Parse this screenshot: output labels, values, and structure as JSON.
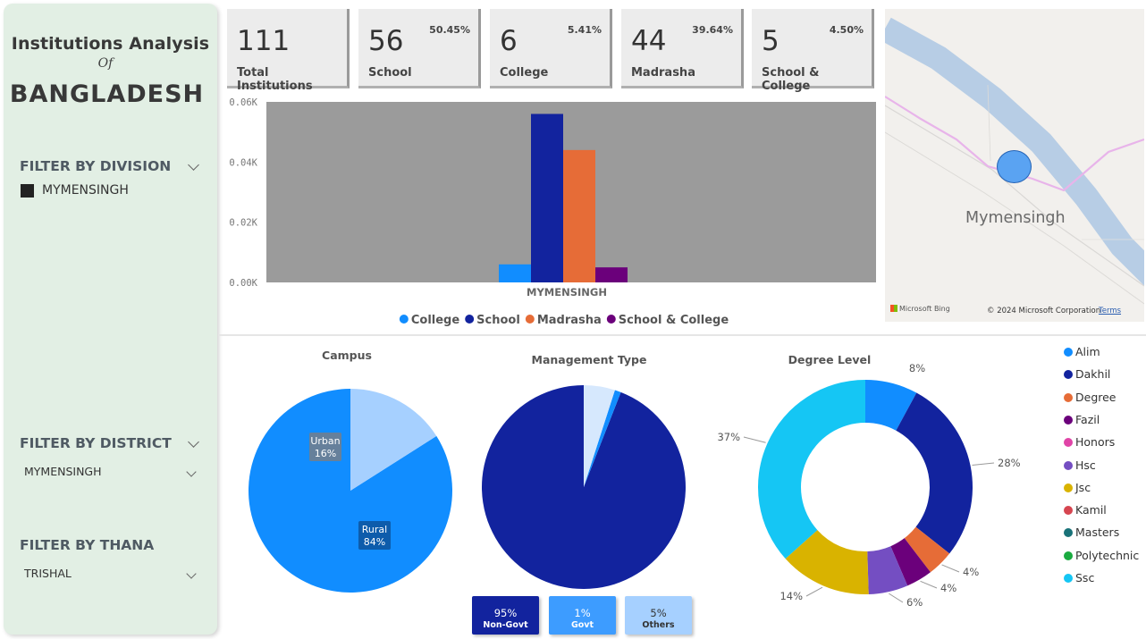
{
  "sidebar": {
    "title_line1": "Institutions Analysis",
    "title_of": "Of",
    "title_line2": "BANGLADESH",
    "division": {
      "label": "FILTER BY DIVISION",
      "selected": "MYMENSINGH"
    },
    "district": {
      "label": "FILTER BY DISTRICT",
      "value": "MYMENSINGH"
    },
    "thana": {
      "label": "FILTER BY THANA",
      "value": "TRISHAL"
    }
  },
  "kpis": [
    {
      "value": "111",
      "label": "Total Institutions",
      "pct": ""
    },
    {
      "value": "56",
      "label": "School",
      "pct": "50.45%"
    },
    {
      "value": "6",
      "label": "College",
      "pct": "5.41%"
    },
    {
      "value": "44",
      "label": "Madrasha",
      "pct": "39.64%"
    },
    {
      "value": "5",
      "label": "School & College",
      "pct": "4.50%"
    }
  ],
  "chart_data": [
    {
      "type": "bar",
      "categories": [
        "MYMENSINGH"
      ],
      "y_ticks": [
        "0.06K",
        "0.04K",
        "0.02K",
        "0.00K"
      ],
      "ylim": [
        0,
        60
      ],
      "legend_position": "bottom",
      "series": [
        {
          "name": "College",
          "values": [
            6
          ],
          "color": "#118dff"
        },
        {
          "name": "School",
          "values": [
            56
          ],
          "color": "#12239e"
        },
        {
          "name": "Madrasha",
          "values": [
            44
          ],
          "color": "#e66c37"
        },
        {
          "name": "School & College",
          "values": [
            5
          ],
          "color": "#6b007b"
        }
      ],
      "plot_background": "#9b9b9b"
    },
    {
      "type": "pie",
      "title": "Campus",
      "slices": [
        {
          "name": "Rural",
          "value": 84,
          "label": "84%",
          "color": "#118dff"
        },
        {
          "name": "Urban",
          "value": 16,
          "label": "16%",
          "color": "#a6d0ff"
        }
      ]
    },
    {
      "type": "pie",
      "title": "Management Type",
      "slices": [
        {
          "name": "Non-Govt",
          "value": 95,
          "label": "95%",
          "color": "#12239e"
        },
        {
          "name": "Govt",
          "value": 1,
          "label": "1%",
          "color": "#118dff"
        },
        {
          "name": "Others",
          "value": 5,
          "label": "5%",
          "color": "#d6e8fd"
        }
      ]
    },
    {
      "type": "pie",
      "title": "Degree Level",
      "donut": true,
      "legend_position": "right",
      "slices": [
        {
          "name": "Alim",
          "value": 8,
          "label": "8%",
          "color": "#118dff"
        },
        {
          "name": "Dakhil",
          "value": 28,
          "label": "28%",
          "color": "#12239e"
        },
        {
          "name": "Degree",
          "value": 4,
          "label": "4%",
          "color": "#e66c37"
        },
        {
          "name": "Fazil",
          "value": 4,
          "label": "4%",
          "color": "#6b007b"
        },
        {
          "name": "Honors",
          "value": 0,
          "label": "",
          "color": "#e044a7"
        },
        {
          "name": "Hsc",
          "value": 6,
          "label": "6%",
          "color": "#744ec2"
        },
        {
          "name": "Jsc",
          "value": 14,
          "label": "14%",
          "color": "#d9b300"
        },
        {
          "name": "Kamil",
          "value": 0,
          "label": "",
          "color": "#d64550"
        },
        {
          "name": "Masters",
          "value": 0,
          "label": "",
          "color": "#197278"
        },
        {
          "name": "Polytechnic",
          "value": 0,
          "label": "",
          "color": "#1aab40"
        },
        {
          "name": "Ssc",
          "value": 37,
          "label": "37%",
          "color": "#15c6f4"
        }
      ]
    }
  ],
  "mgmt_badges": [
    {
      "pct": "95%",
      "name": "Non-Govt",
      "color": "#12239e"
    },
    {
      "pct": "1%",
      "name": "Govt",
      "color": "#3d9cff"
    },
    {
      "pct": "5%",
      "name": "Others",
      "color": "#a6d0ff"
    }
  ],
  "map": {
    "city": "Mymensingh",
    "brand": "Microsoft Bing",
    "copyright": "© 2024 Microsoft Corporation",
    "terms": "Terms"
  }
}
